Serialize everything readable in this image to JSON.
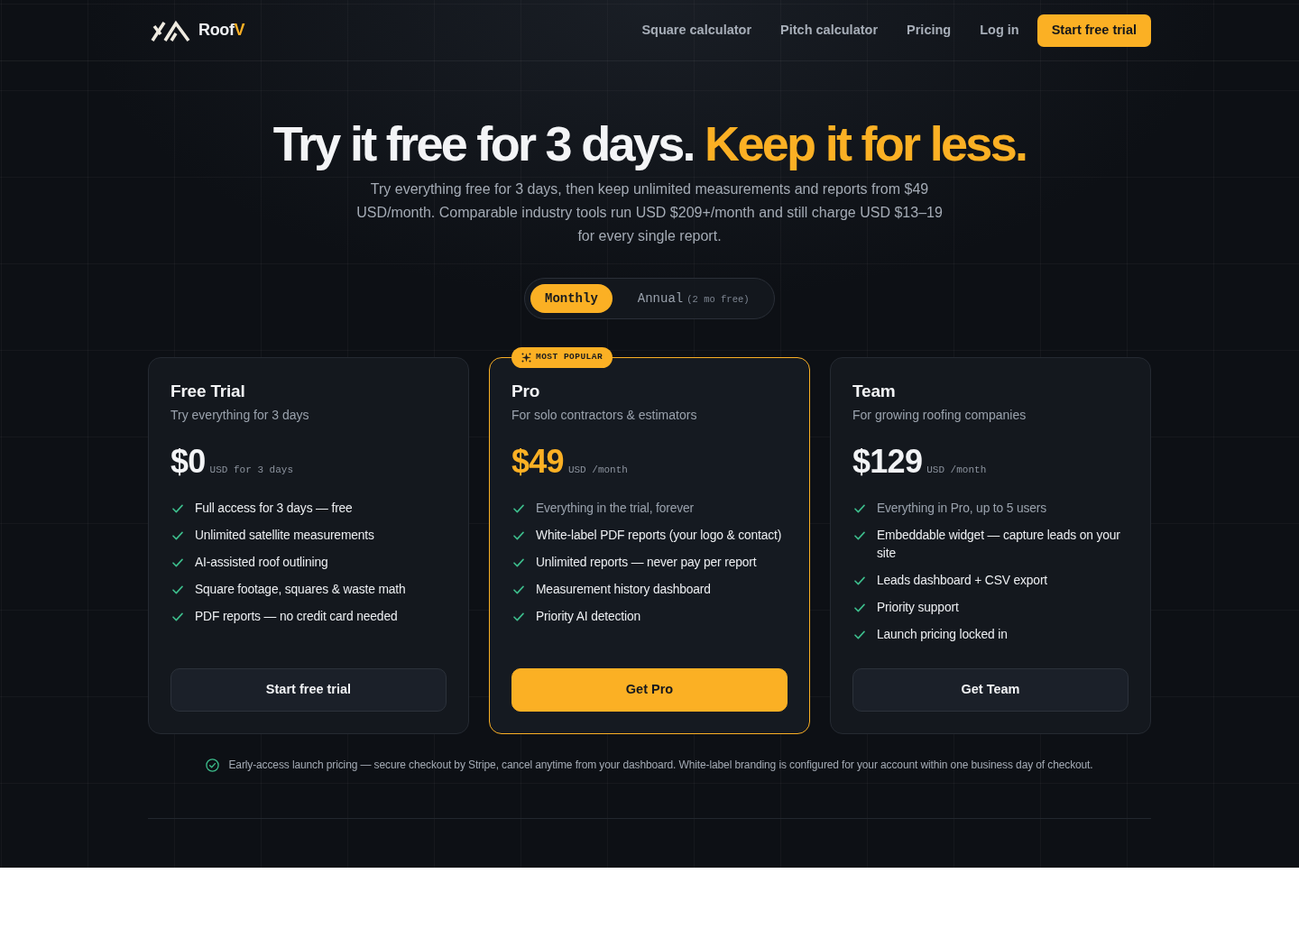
{
  "nav": {
    "brand": {
      "text": "Roof",
      "accent": "V"
    },
    "links": [
      "Square calculator",
      "Pitch calculator",
      "Pricing",
      "Log in"
    ],
    "cta": "Start free trial"
  },
  "hero": {
    "title": "Try it free for 3 days.",
    "title_highlight": "Keep it for less.",
    "subtitle": "Try everything free for 3 days, then keep unlimited measurements and reports from $49 USD/month. Comparable industry tools run USD $209+/month and still charge USD $13–19 for every single report."
  },
  "billing_toggle": {
    "options": [
      {
        "label": "Monthly",
        "selected": true
      },
      {
        "label": "Annual",
        "note": "(2 mo free)",
        "selected": false
      }
    ]
  },
  "plans": [
    {
      "name": "Free Trial",
      "description": "Try everything for 3 days",
      "price": "$0",
      "price_note": "USD for 3 days",
      "featured": false,
      "features": [
        {
          "text": "Full access for 3 days — free",
          "muted": false
        },
        {
          "text": "Unlimited satellite measurements",
          "muted": false
        },
        {
          "text": "AI-assisted roof outlining",
          "muted": false
        },
        {
          "text": "Square footage, squares & waste math",
          "muted": false
        },
        {
          "text": "PDF reports — no credit card needed",
          "muted": false
        }
      ],
      "button": "Start free trial"
    },
    {
      "badge": "MOST POPULAR",
      "name": "Pro",
      "description": "For solo contractors & estimators",
      "price": "$49",
      "price_note": "USD /month",
      "featured": true,
      "features": [
        {
          "text": "Everything in the trial, forever",
          "muted": true
        },
        {
          "text": "White-label PDF reports (your logo & contact)",
          "muted": false
        },
        {
          "text": "Unlimited reports — never pay per report",
          "muted": false
        },
        {
          "text": "Measurement history dashboard",
          "muted": false
        },
        {
          "text": "Priority AI detection",
          "muted": false
        }
      ],
      "button": "Get Pro"
    },
    {
      "name": "Team",
      "description": "For growing roofing companies",
      "price": "$129",
      "price_note": "USD /month",
      "featured": false,
      "features": [
        {
          "text": "Everything in Pro, up to 5 users",
          "muted": true
        },
        {
          "text": "Embeddable widget — capture leads on your site",
          "muted": false
        },
        {
          "text": "Leads dashboard + CSV export",
          "muted": false
        },
        {
          "text": "Priority support",
          "muted": false
        },
        {
          "text": "Launch pricing locked in",
          "muted": false
        }
      ],
      "button": "Get Team"
    }
  ],
  "footnote": "Early-access launch pricing — secure checkout by Stripe, cancel anytime from your dashboard. White-label branding is configured for your account within one business day of checkout."
}
